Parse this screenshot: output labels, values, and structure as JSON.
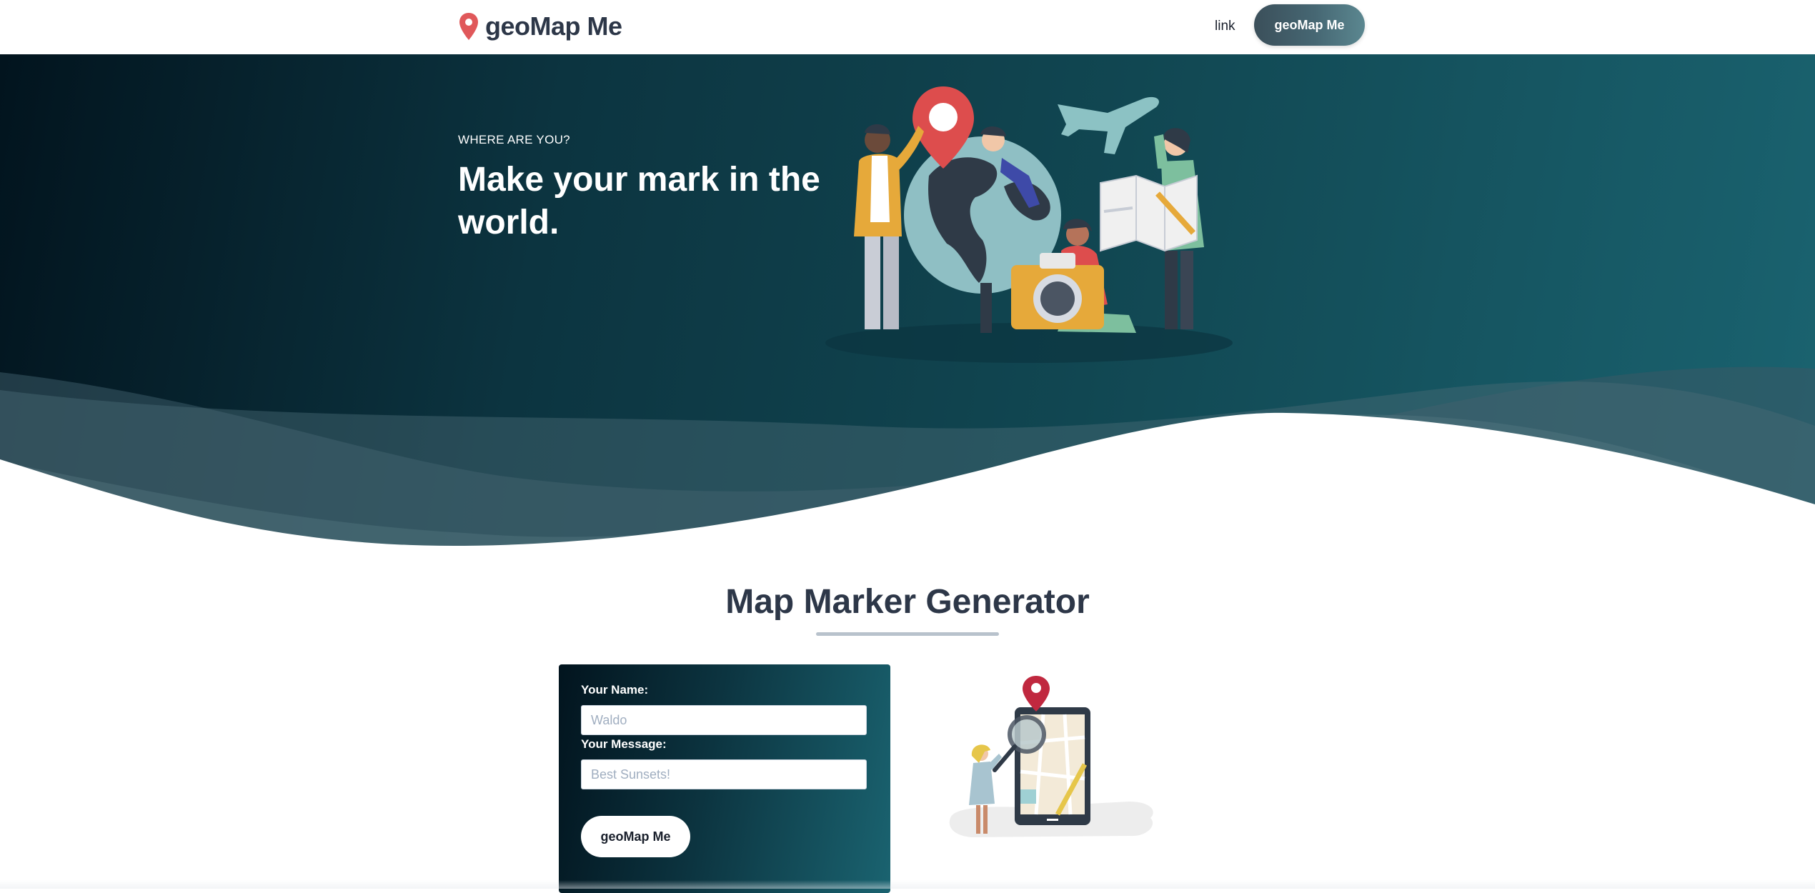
{
  "nav": {
    "brand": "geoMap Me",
    "link_label": "link",
    "cta_label": "geoMap Me"
  },
  "hero": {
    "eyebrow": "WHERE ARE YOU?",
    "headline": "Make your mark in the world."
  },
  "section": {
    "title": "Map Marker Generator"
  },
  "form": {
    "name_label": "Your Name:",
    "name_placeholder": "Waldo",
    "message_label": "Your Message:",
    "message_placeholder": "Best Sunsets!",
    "submit_label": "geoMap Me"
  },
  "colors": {
    "brand_pin": "#e0585a",
    "hero_dark": "#02141e",
    "hero_teal": "#1a6370",
    "text_dark": "#2d3748"
  },
  "icons": {
    "brand": "map-pin-icon"
  }
}
